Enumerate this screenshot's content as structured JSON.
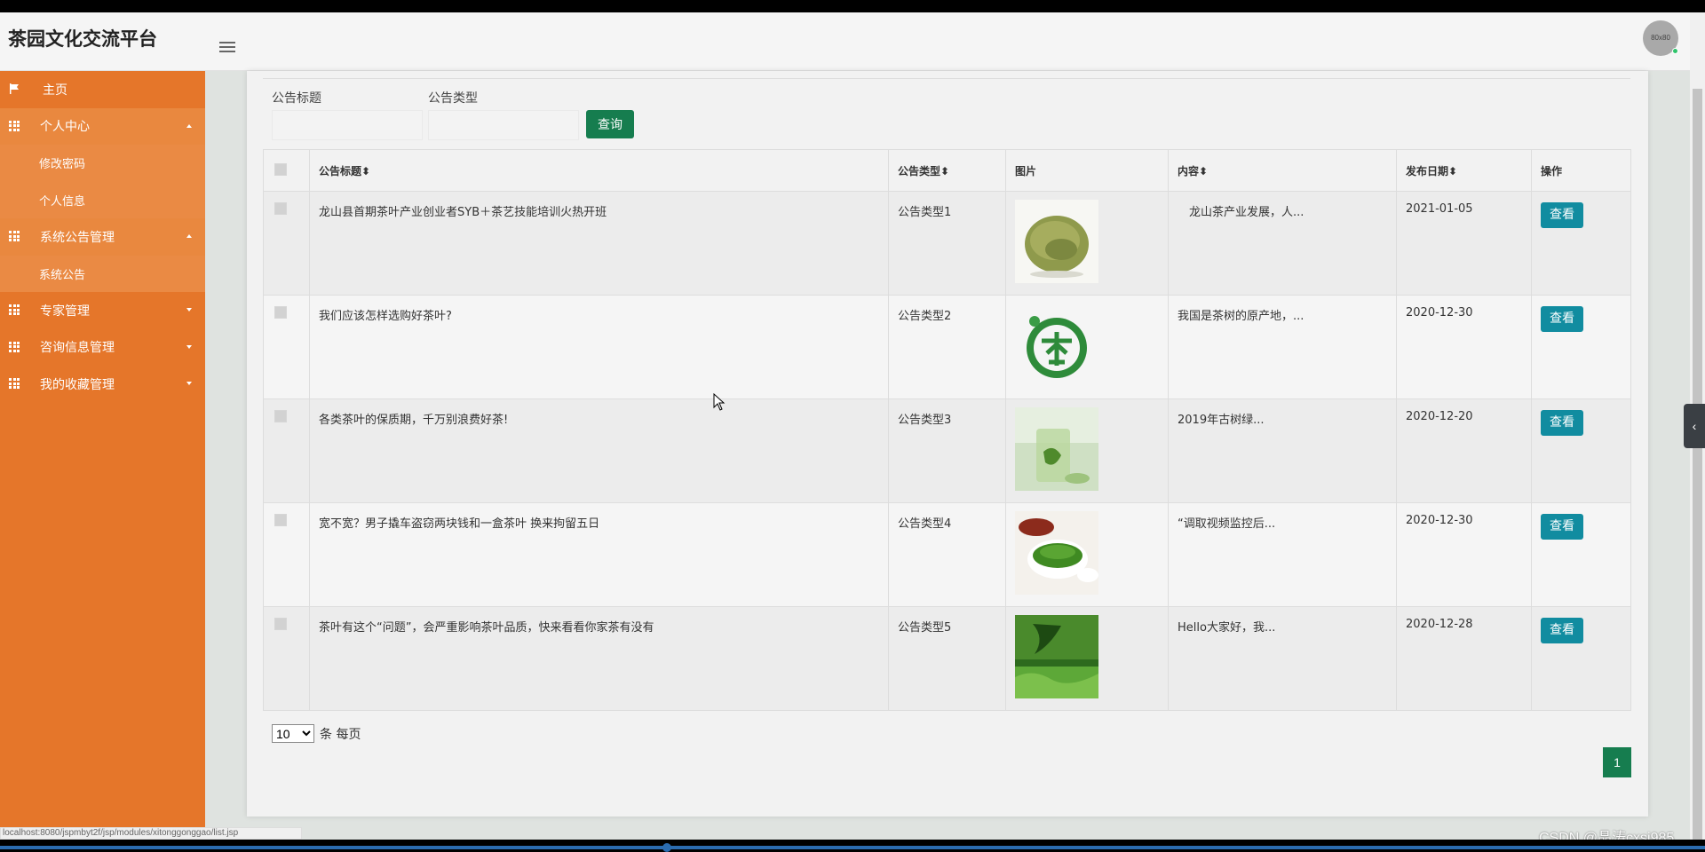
{
  "header": {
    "brand": "茶园文化交流平台",
    "avatar_text": "80x80"
  },
  "sidebar": {
    "items": [
      {
        "label": "主页",
        "icon": "flag-icon"
      },
      {
        "label": "个人中心",
        "icon": "grid-icon",
        "expanded": true,
        "children": [
          {
            "label": "修改密码"
          },
          {
            "label": "个人信息"
          }
        ]
      },
      {
        "label": "系统公告管理",
        "icon": "grid-icon",
        "expanded": true,
        "children": [
          {
            "label": "系统公告"
          }
        ]
      },
      {
        "label": "专家管理",
        "icon": "grid-icon",
        "expanded": false
      },
      {
        "label": "咨询信息管理",
        "icon": "grid-icon",
        "expanded": false
      },
      {
        "label": "我的收藏管理",
        "icon": "grid-icon",
        "expanded": false
      }
    ]
  },
  "filters": {
    "title_label": "公告标题",
    "title_value": "",
    "type_label": "公告类型",
    "type_value": "",
    "search_button": "查询"
  },
  "table": {
    "headers": [
      "公告标题",
      "公告类型",
      "图片",
      "内容",
      "发布日期",
      "操作"
    ],
    "rows": [
      {
        "title": "龙山县首期茶叶产业创业者SYB＋茶艺技能培训火热开班",
        "type": "公告类型1",
        "image": "dried-tea-leaves",
        "content": "　龙山茶产业发展，人...",
        "date": "2021-01-05",
        "action": "查看"
      },
      {
        "title": "我们应该怎样选购好茶叶?",
        "type": "公告类型2",
        "image": "tea-character-logo",
        "content": "我国是茶树的原产地，...",
        "date": "2020-12-30",
        "action": "查看"
      },
      {
        "title": "各类茶叶的保质期，千万别浪费好茶!",
        "type": "公告类型3",
        "image": "green-tea-glass",
        "content": "2019年古树绿...",
        "date": "2020-12-20",
        "action": "查看"
      },
      {
        "title": "宽不宽？男子撬车盗窃两块钱和一盒茶叶 换来拘留五日",
        "type": "公告类型4",
        "image": "tea-bowl-leaves",
        "content": "“调取视频监控后...",
        "date": "2020-12-30",
        "action": "查看"
      },
      {
        "title": "茶叶有这个“问题”，会严重影响茶叶品质，快来看看你家茶有没有",
        "type": "公告类型5",
        "image": "tea-field-poster",
        "content": "Hello大家好，我...",
        "date": "2020-12-28",
        "action": "查看"
      }
    ]
  },
  "pagination": {
    "page_size": "10",
    "page_size_suffix": "条 每页",
    "current_page": "1"
  },
  "status_url": "localhost:8080/jspmbyt2f/jsp/modules/xitonggonggao/list.jsp",
  "watermark": "CSDN @晶涛cxsj985",
  "colors": {
    "sidebar": "#e5762a",
    "primary_green": "#167d4f",
    "view_button": "#118ca0"
  }
}
